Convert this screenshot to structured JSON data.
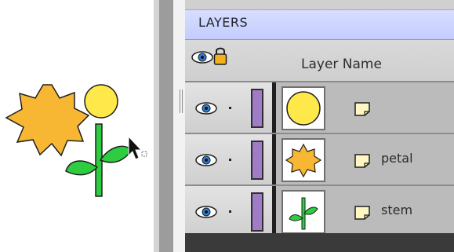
{
  "canvas": {
    "cursor_icon": "arrow-cursor-icon",
    "artwork": "flower-with-petal-circle-and-stem"
  },
  "panel": {
    "title": "LAYERS",
    "header": {
      "visibility_icon": "eye-icon",
      "lock_icon": "lock-icon",
      "column_label": "Layer Name"
    },
    "layers": [
      {
        "name": "",
        "thumbnail": "yellow-circle",
        "swatch_color": "#a07bc8"
      },
      {
        "name": "petal",
        "thumbnail": "orange-star-petal",
        "swatch_color": "#a07bc8"
      },
      {
        "name": "stem",
        "thumbnail": "green-stem",
        "swatch_color": "#a07bc8"
      }
    ]
  },
  "colors": {
    "tab_bg": "#c8d0ff",
    "petal": "#f7b733",
    "circle": "#ffe84a",
    "stem": "#2ecc40",
    "swatch": "#a07bc8"
  }
}
